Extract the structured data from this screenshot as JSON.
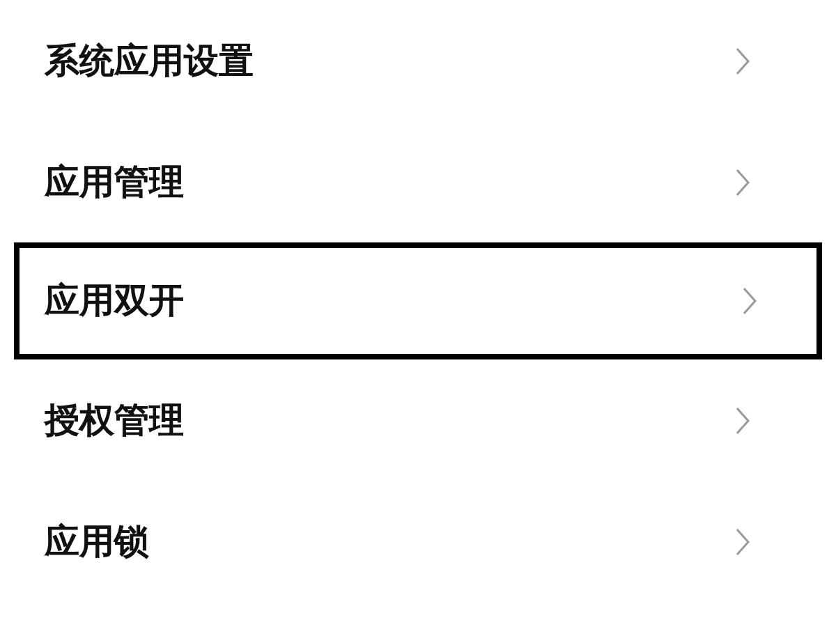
{
  "items": [
    {
      "label": "系统应用设置",
      "highlighted": false
    },
    {
      "label": "应用管理",
      "highlighted": false
    },
    {
      "label": "应用双开",
      "highlighted": true
    },
    {
      "label": "授权管理",
      "highlighted": false
    },
    {
      "label": "应用锁",
      "highlighted": false
    }
  ]
}
